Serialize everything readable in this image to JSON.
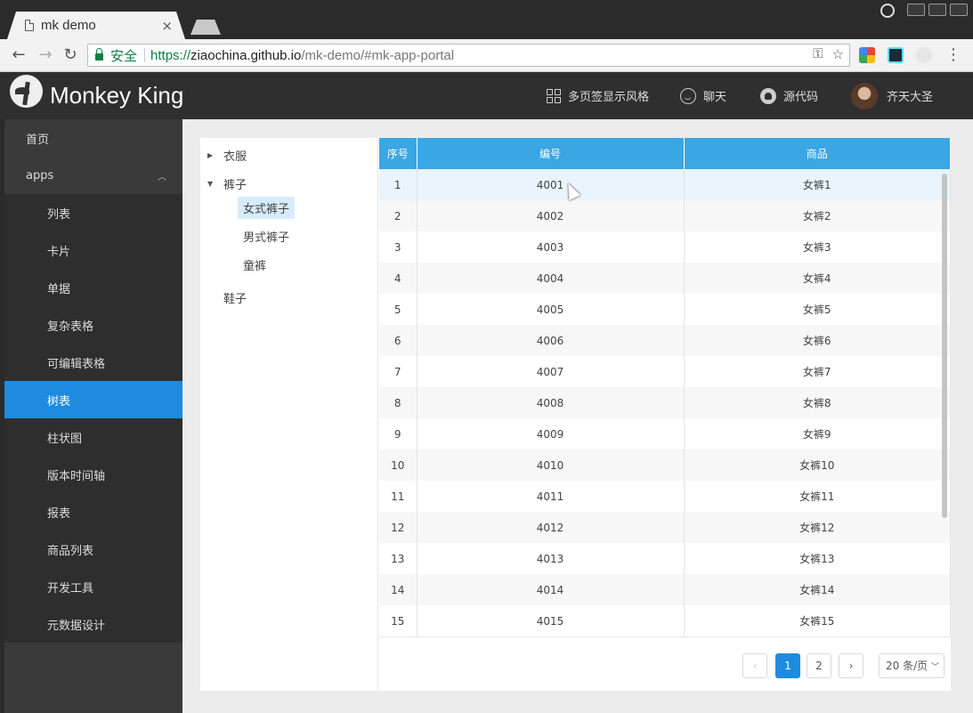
{
  "browser": {
    "tab_title": "mk demo",
    "tab_close": "×",
    "secure_label": "安全",
    "url_scheme": "https://",
    "url_host": "ziaochina.github.io",
    "url_path": "/mk-demo/#mk-app-portal"
  },
  "header": {
    "brand": "Monkey King",
    "items": [
      {
        "label": "多页签显示风格",
        "icon": "grid-icon"
      },
      {
        "label": "聊天",
        "icon": "smile-icon"
      },
      {
        "label": "源代码",
        "icon": "github-icon"
      },
      {
        "label": "齐天大圣",
        "icon": "avatar"
      }
    ]
  },
  "sidebar": {
    "items": [
      {
        "label": "首页"
      },
      {
        "label": "apps"
      },
      {
        "label": "列表"
      },
      {
        "label": "卡片"
      },
      {
        "label": "单据"
      },
      {
        "label": "复杂表格"
      },
      {
        "label": "可编辑表格"
      },
      {
        "label": "树表"
      },
      {
        "label": "柱状图"
      },
      {
        "label": "版本时间轴"
      },
      {
        "label": "报表"
      },
      {
        "label": "商品列表"
      },
      {
        "label": "开发工具"
      },
      {
        "label": "元数据设计"
      }
    ],
    "active": "树表"
  },
  "tree": {
    "nodes": [
      {
        "label": "衣服",
        "expanded": false
      },
      {
        "label": "裤子",
        "expanded": true
      },
      {
        "label": "鞋子",
        "expanded": false
      }
    ],
    "children": [
      {
        "label": "女式裤子",
        "selected": true
      },
      {
        "label": "男式裤子"
      },
      {
        "label": "童裤"
      }
    ]
  },
  "table": {
    "headers": [
      "序号",
      "编号",
      "商品"
    ],
    "rows": [
      [
        "1",
        "4001",
        "女裤1"
      ],
      [
        "2",
        "4002",
        "女裤2"
      ],
      [
        "3",
        "4003",
        "女裤3"
      ],
      [
        "4",
        "4004",
        "女裤4"
      ],
      [
        "5",
        "4005",
        "女裤5"
      ],
      [
        "6",
        "4006",
        "女裤6"
      ],
      [
        "7",
        "4007",
        "女裤7"
      ],
      [
        "8",
        "4008",
        "女裤8"
      ],
      [
        "9",
        "4009",
        "女裤9"
      ],
      [
        "10",
        "4010",
        "女裤10"
      ],
      [
        "11",
        "4011",
        "女裤11"
      ],
      [
        "12",
        "4012",
        "女裤12"
      ],
      [
        "13",
        "4013",
        "女裤13"
      ],
      [
        "14",
        "4014",
        "女裤14"
      ],
      [
        "15",
        "4015",
        "女裤15"
      ]
    ]
  },
  "pager": {
    "prev": "‹",
    "pages": [
      "1",
      "2"
    ],
    "current": "1",
    "next": "›",
    "page_size": "20 条/页"
  },
  "colors": {
    "accent": "#1e8be0",
    "table_header": "#3aa6e4",
    "sidebar_bg": "#3a3a3a",
    "header_bg": "#2f2f2f"
  }
}
